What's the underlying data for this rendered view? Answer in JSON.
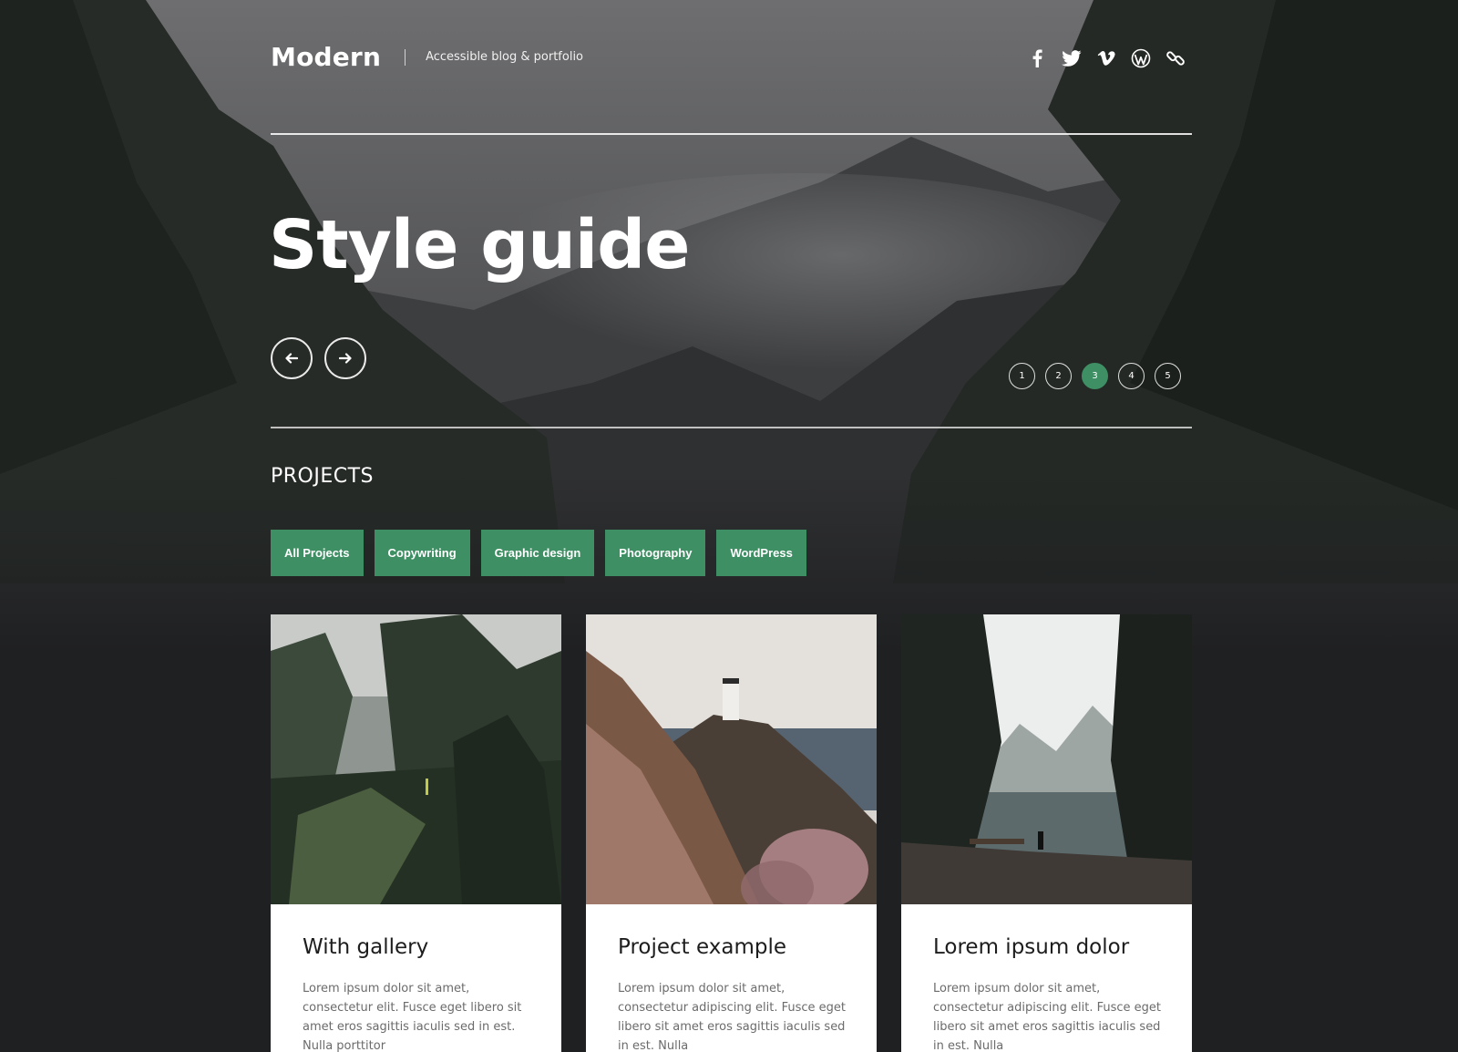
{
  "header": {
    "site_title": "Modern",
    "tagline": "Accessible blog & portfolio",
    "social": [
      {
        "icon": "facebook-icon"
      },
      {
        "icon": "twitter-icon"
      },
      {
        "icon": "vimeo-icon"
      },
      {
        "icon": "wordpress-icon"
      },
      {
        "icon": "link-icon"
      }
    ]
  },
  "hero": {
    "title": "Style guide",
    "prev_icon": "arrow-left-icon",
    "next_icon": "arrow-right-icon",
    "pages": [
      "1",
      "2",
      "3",
      "4",
      "5"
    ],
    "active_page": "3"
  },
  "projects": {
    "heading": "PROJECTS",
    "filters": [
      "All Projects",
      "Copywriting",
      "Graphic design",
      "Photography",
      "WordPress"
    ],
    "cards": [
      {
        "title": "With gallery",
        "text": "Lorem ipsum dolor sit amet, consectetur elit. Fusce eget libero sit amet eros sagittis iaculis sed in est. Nulla porttitor"
      },
      {
        "title": "Project example",
        "text": "Lorem ipsum dolor sit amet, consectetur adipiscing elit. Fusce eget libero sit amet eros sagittis iaculis sed in est. Nulla"
      },
      {
        "title": "Lorem ipsum dolor",
        "text": "Lorem ipsum dolor sit amet, consectetur adipiscing elit. Fusce eget libero sit amet eros sagittis iaculis sed in est. Nulla"
      }
    ]
  },
  "colors": {
    "accent": "#3f8f64",
    "background": "#1f2022",
    "card": "#ffffff"
  }
}
